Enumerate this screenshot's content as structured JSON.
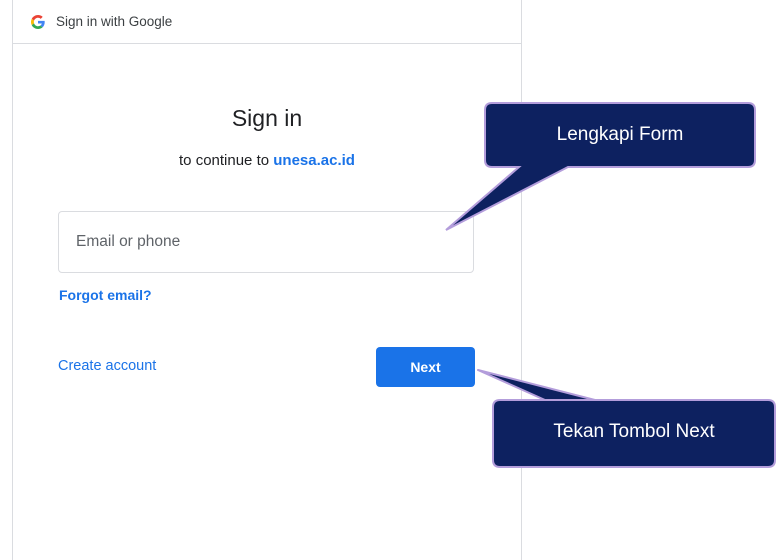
{
  "header": {
    "title": "Sign in with Google",
    "logo_icon": "google-g-icon"
  },
  "signin": {
    "title": "Sign in",
    "subtitle_prefix": "to continue to",
    "domain": "unesa.ac.id",
    "email_placeholder": "Email or phone",
    "email_value": "",
    "forgot_email": "Forgot email?",
    "create_account": "Create account",
    "next_label": "Next"
  },
  "callouts": {
    "form": "Lengkapi Form",
    "next": "Tekan Tombol Next"
  },
  "colors": {
    "accent": "#1a73e8",
    "callout_fill": "#0d2160",
    "callout_border": "#b39ddb"
  }
}
